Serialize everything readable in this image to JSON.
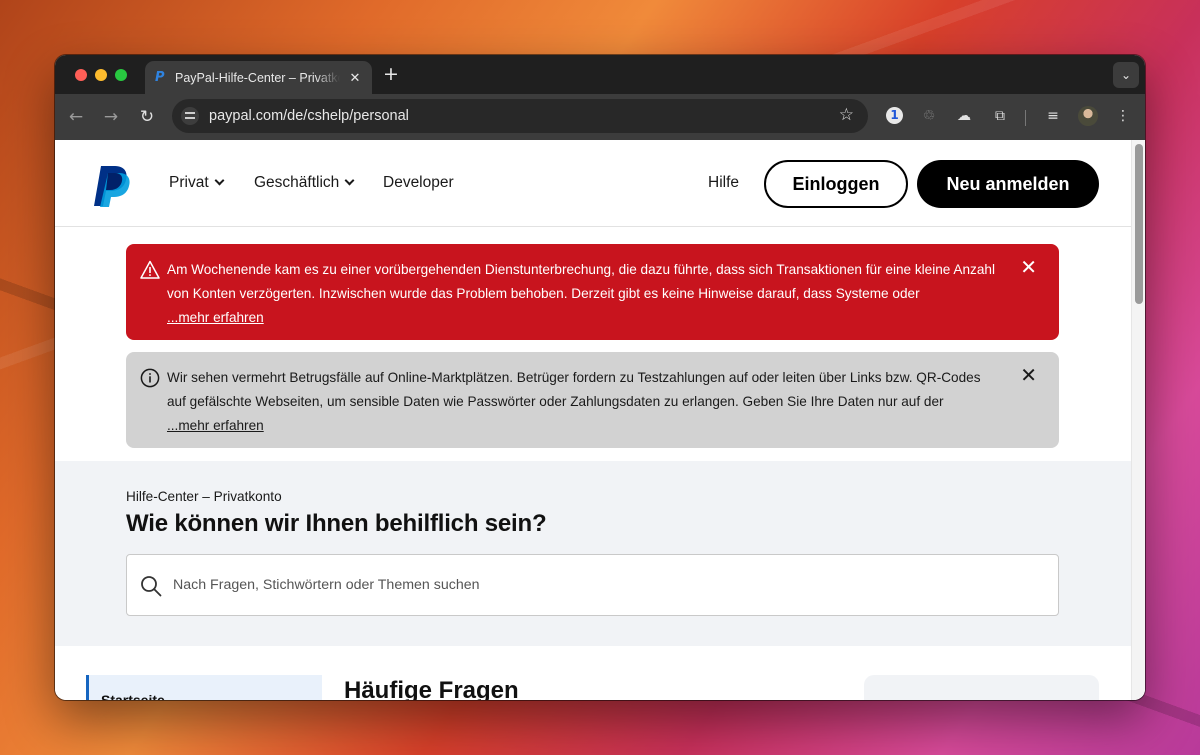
{
  "browser": {
    "tab_title": "PayPal-Hilfe-Center – Privatkonto",
    "tab_close": "✕",
    "new_tab": "+",
    "url": "paypal.com/de/cshelp/personal"
  },
  "header": {
    "nav": [
      {
        "label": "Privat"
      },
      {
        "label": "Geschäftlich"
      },
      {
        "label": "Developer"
      }
    ],
    "help": "Hilfe",
    "login": "Einloggen",
    "signup": "Neu anmelden"
  },
  "alerts": [
    {
      "type": "warning",
      "text": "Am Wochenende kam es zu einer vorübergehenden Dienstunterbrechung, die dazu führte, dass sich Transaktionen für eine kleine Anzahl von Konten verzögerten. Inzwischen wurde das Problem behoben. Derzeit gibt es keine Hinweise darauf, dass Systeme oder",
      "more": "...mehr erfahren",
      "close": "✕",
      "color": "#c8141e"
    },
    {
      "type": "info",
      "text": "Wir sehen vermehrt Betrugsfälle auf Online-Marktplätzen. Betrüger fordern zu Testzahlungen auf oder leiten über Links bzw. QR-Codes auf gefälschte Webseiten, um sensible Daten wie Passwörter oder Zahlungsdaten zu erlangen. Geben Sie Ihre Daten nur auf der",
      "more": "...mehr erfahren",
      "close": "✕",
      "color": "#d2d2d2"
    }
  ],
  "hero": {
    "breadcrumb": "Hilfe-Center – Privatkonto",
    "title": "Wie können wir Ihnen behilflich sein?",
    "search_placeholder": "Nach Fragen, Stichwörtern oder Themen suchen"
  },
  "content": {
    "sidebar_first_item": "Startseite",
    "faq_title": "Häufige Fragen"
  },
  "colors": {
    "paypal_dark_blue": "#003087",
    "paypal_light_blue": "#009cde",
    "primary_black": "#000000"
  }
}
